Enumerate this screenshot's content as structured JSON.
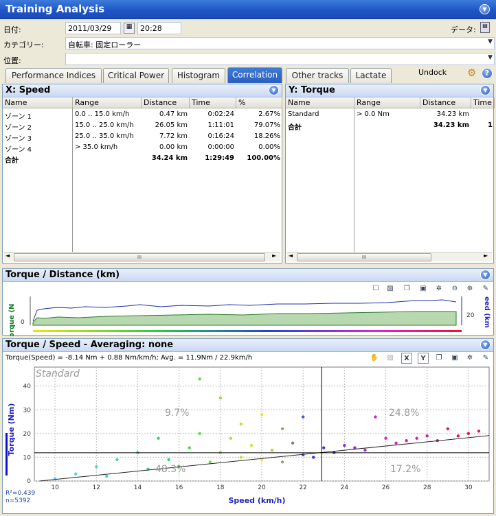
{
  "window": {
    "title": "Training Analysis"
  },
  "form": {
    "date_label": "日付:",
    "date_value": "2011/03/29",
    "time_value": "20:28",
    "data_label": "データ:",
    "category_label": "カテゴリー:",
    "category_value": "自転車: 固定ローラー",
    "location_label": "位置:",
    "location_value": ""
  },
  "tabs": [
    "Performance Indices",
    "Critical Power",
    "Histogram",
    "Correlation",
    "Other tracks",
    "Lactate"
  ],
  "active_tab": "Correlation",
  "undock_label": "Undock",
  "x_panel": {
    "title": "X: Speed",
    "columns": [
      "Name",
      "Range",
      "Distance",
      "Time",
      "%"
    ],
    "rows": [
      [
        "ゾーン 1",
        "0.0 .. 15.0 km/h",
        "0.47 km",
        "0:02:24",
        "2.67%"
      ],
      [
        "ゾーン 2",
        "15.0 .. 25.0 km/h",
        "26.05 km",
        "1:11:01",
        "79.07%"
      ],
      [
        "ゾーン 3",
        "25.0 .. 35.0 km/h",
        "7.72 km",
        "0:16:24",
        "18.26%"
      ],
      [
        "ゾーン 4",
        "> 35.0 km/h",
        "0.00 km",
        "0:00:00",
        "0.00%"
      ]
    ],
    "total": [
      "合計",
      "",
      "34.24 km",
      "1:29:49",
      "100.00%"
    ]
  },
  "y_panel": {
    "title": "Y: Torque",
    "columns": [
      "Name",
      "Range",
      "Distance",
      "Time"
    ],
    "rows": [
      [
        "Standard",
        "> 0.0 Nm",
        "34.23 km",
        ""
      ]
    ],
    "total": [
      "合計",
      "",
      "34.23 km",
      "1"
    ]
  },
  "scroll_grip": "III",
  "dist_chart": {
    "title": "Torque / Distance (km)",
    "left_axis": "Torque (N",
    "right_axis": "eed (km",
    "left_tick": "0",
    "right_tick": "20"
  },
  "corr_chart": {
    "title": "Torque / Speed - Averaging: none",
    "formula": "Torque(Speed) = -8.14 Nm + 0.88 Nm/km/h; Avg. = 11.9Nm / 22.9km/h",
    "series_label": "Standard",
    "quadrants": [
      "9.7%",
      "24.8%",
      "48.3%",
      "17.2%"
    ],
    "r2": "R²=0.439",
    "n": "n=5392"
  },
  "chart_data": {
    "type": "scatter",
    "title": "Torque / Speed - Averaging: none",
    "xlabel": "Speed (km/h)",
    "ylabel": "Torque (Nm)",
    "xlim": [
      9,
      31
    ],
    "ylim": [
      0,
      48
    ],
    "x_ticks": [
      10,
      12,
      14,
      16,
      18,
      20,
      22,
      24,
      26,
      28,
      30
    ],
    "y_ticks": [
      0,
      10,
      20,
      30,
      40
    ],
    "regression": {
      "intercept": -8.14,
      "slope": 0.88
    },
    "avg": {
      "x": 22.9,
      "y": 11.9
    },
    "grid": true,
    "series": [
      {
        "name": "Standard",
        "points": [
          [
            10,
            1
          ],
          [
            11,
            3
          ],
          [
            12,
            6
          ],
          [
            12.5,
            2
          ],
          [
            13,
            9
          ],
          [
            14,
            12
          ],
          [
            14.5,
            5
          ],
          [
            15,
            18
          ],
          [
            15.5,
            9
          ],
          [
            16,
            6
          ],
          [
            16.5,
            14
          ],
          [
            17,
            20
          ],
          [
            17,
            43
          ],
          [
            17.5,
            8
          ],
          [
            18,
            12
          ],
          [
            18,
            35
          ],
          [
            18.5,
            18
          ],
          [
            19,
            10
          ],
          [
            19,
            24
          ],
          [
            19.5,
            15
          ],
          [
            20,
            9
          ],
          [
            20,
            28
          ],
          [
            20.5,
            13
          ],
          [
            21,
            8
          ],
          [
            21,
            22
          ],
          [
            21.5,
            16
          ],
          [
            22,
            11
          ],
          [
            22,
            27
          ],
          [
            22.5,
            10
          ],
          [
            23,
            14
          ],
          [
            23.5,
            12
          ],
          [
            24,
            15
          ],
          [
            24.5,
            14
          ],
          [
            25,
            13
          ],
          [
            25.5,
            27
          ],
          [
            26,
            18
          ],
          [
            26.5,
            16
          ],
          [
            27,
            17
          ],
          [
            27.5,
            18
          ],
          [
            28,
            19
          ],
          [
            28.5,
            17
          ],
          [
            29,
            22
          ],
          [
            29.5,
            19
          ],
          [
            30,
            20
          ],
          [
            30.5,
            21
          ]
        ]
      }
    ]
  }
}
